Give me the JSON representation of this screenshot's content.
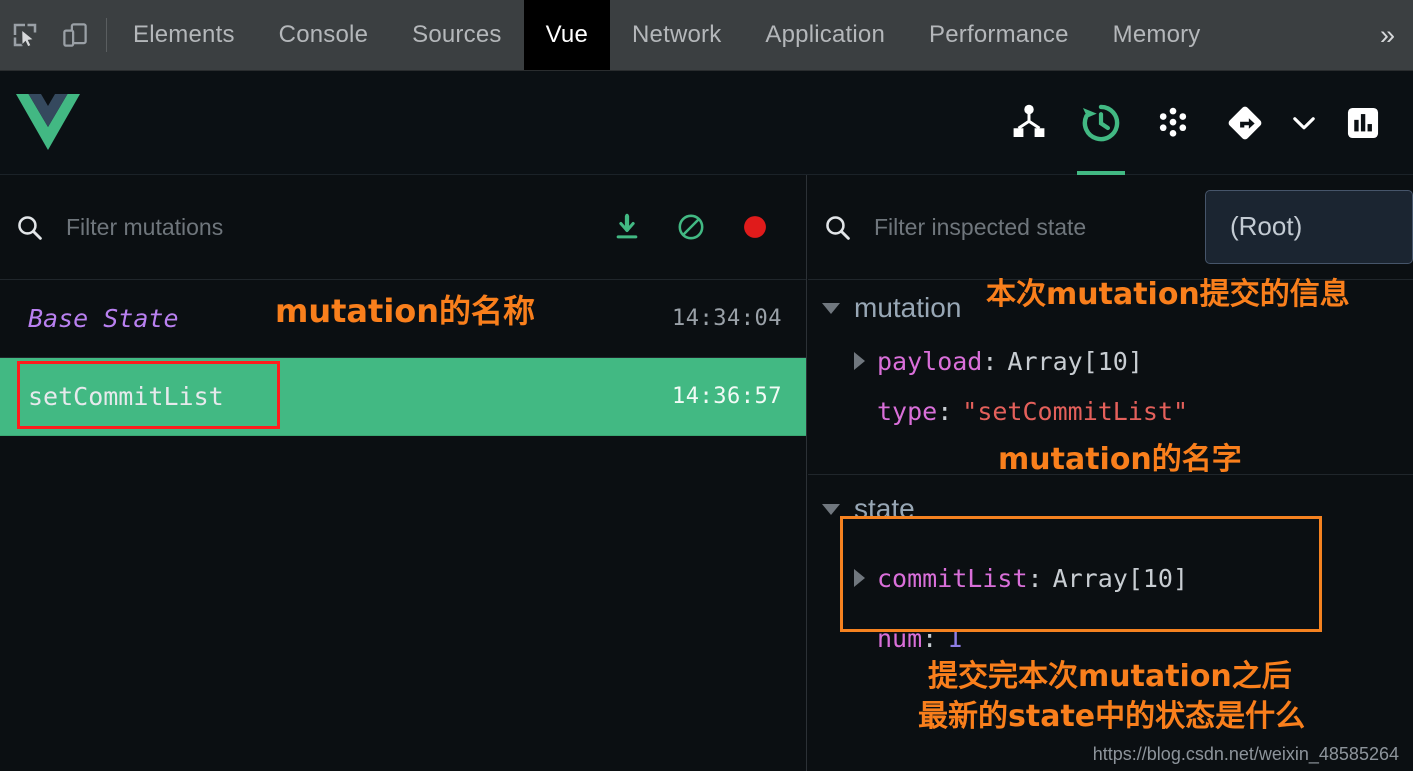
{
  "devtools": {
    "icons": [
      {
        "name": "inspect-element-icon",
        "label": "inspect-element"
      },
      {
        "name": "device-toolbar-icon",
        "label": "device-toolbar"
      }
    ],
    "tabs": [
      {
        "label": "Elements",
        "active": false
      },
      {
        "label": "Console",
        "active": false
      },
      {
        "label": "Sources",
        "active": false
      },
      {
        "label": "Vue",
        "active": true
      },
      {
        "label": "Network",
        "active": false
      },
      {
        "label": "Application",
        "active": false
      },
      {
        "label": "Performance",
        "active": false
      },
      {
        "label": "Memory",
        "active": false
      }
    ],
    "more_label": "»"
  },
  "vue_header": {
    "logo_name": "vue-logo",
    "actions": [
      {
        "name": "components-tree-icon",
        "label": "Components",
        "active": false
      },
      {
        "name": "vuex-history-icon",
        "label": "Vuex",
        "active": true
      },
      {
        "name": "events-icon",
        "label": "Events",
        "active": false
      },
      {
        "name": "routing-icon",
        "label": "Routing",
        "active": false
      },
      {
        "name": "chevron-down-icon",
        "label": "More",
        "active": false
      },
      {
        "name": "performance-icon",
        "label": "Performance",
        "active": false
      }
    ]
  },
  "left_panel": {
    "filter": {
      "placeholder": "Filter mutations",
      "value": "",
      "search_icon": "search-icon"
    },
    "actions": [
      {
        "name": "export-icon",
        "label": "Export",
        "color": "#42b983"
      },
      {
        "name": "clear-icon",
        "label": "Clear",
        "color": "#42b983"
      },
      {
        "name": "record-icon",
        "label": "Recording",
        "color": "#e01b1b"
      }
    ],
    "mutations": [
      {
        "name": "Base State",
        "time": "14:34:04",
        "selected": false,
        "base": true
      },
      {
        "name": "setCommitList",
        "time": "14:36:57",
        "selected": true,
        "base": false
      }
    ]
  },
  "right_panel": {
    "filter": {
      "placeholder": "Filter inspected state",
      "value": "",
      "search_icon": "search-icon"
    },
    "root_button": "(Root)",
    "sections": [
      {
        "title": "mutation",
        "expanded": true,
        "rows": [
          {
            "key": "payload",
            "value": "Array[10]",
            "value_type": "obj",
            "expandable": true
          },
          {
            "key": "type",
            "value": "\"setCommitList\"",
            "value_type": "str",
            "expandable": false
          }
        ]
      },
      {
        "title": "state",
        "expanded": true,
        "rows": [
          {
            "key": "commitList",
            "value": "Array[10]",
            "value_type": "obj",
            "expandable": true
          },
          {
            "key": "num",
            "value": "1",
            "value_type": "num",
            "expandable": false
          }
        ]
      }
    ]
  },
  "annotations": {
    "accent_color": "#f97f1c",
    "highlight_red": "#ff1d1d",
    "highlight_orange": "#f58220",
    "mutation_name_label": "mutation的名称",
    "mutation_info_label": "本次mutation提交的信息",
    "mutation_type_label": "mutation的名字",
    "state_label_line1": "提交完本次mutation之后",
    "state_label_line2": "最新的state中的状态是什么"
  },
  "watermark": "https://blog.csdn.net/weixin_48585264"
}
